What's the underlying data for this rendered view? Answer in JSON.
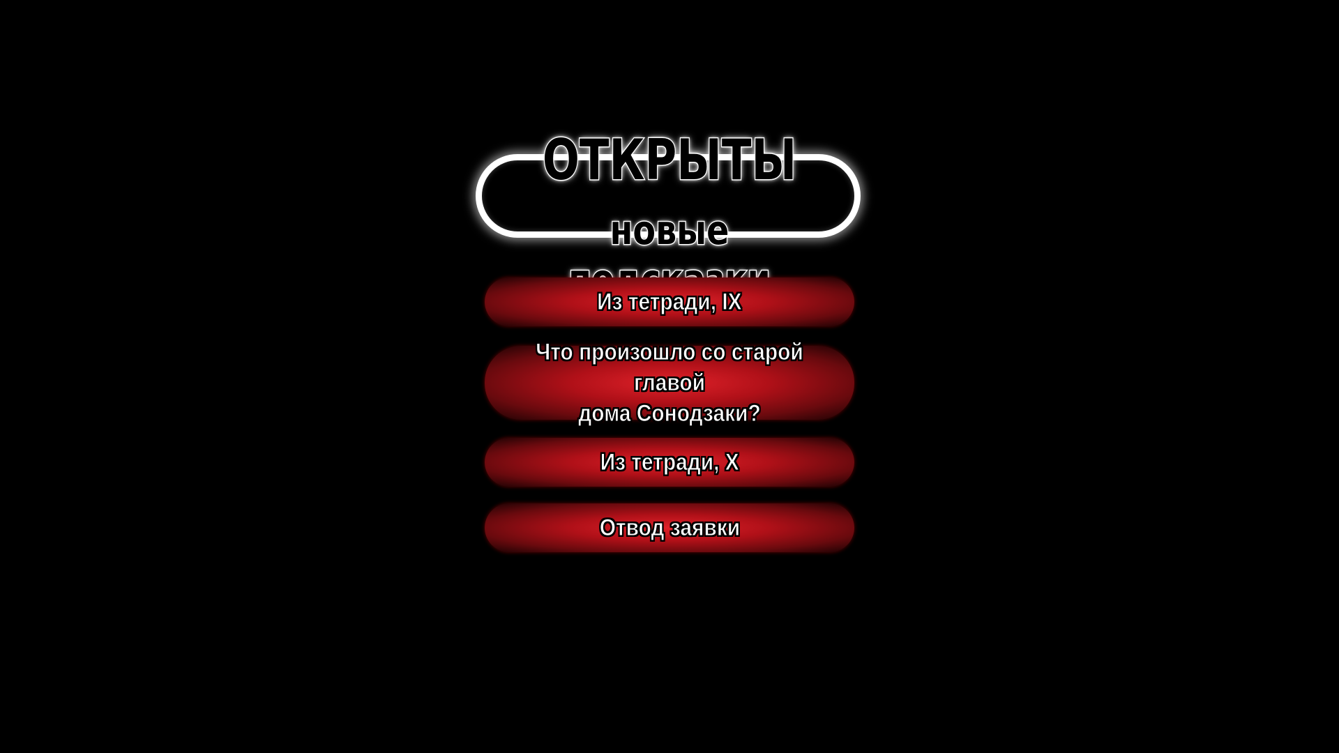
{
  "header": {
    "title": "ОТКРЫТЫ",
    "subtitle": "новые подсказки"
  },
  "hints": [
    {
      "label": "Из тетради, IX"
    },
    {
      "label": "Что произошло со старой главой\nдома Сонодзаки?"
    },
    {
      "label": "Из тетради, X"
    },
    {
      "label": "Отвод заявки"
    }
  ],
  "colors": {
    "background": "#000000",
    "button_red": "#e0222a",
    "button_dark": "#1a0203",
    "text": "#ffffff"
  }
}
